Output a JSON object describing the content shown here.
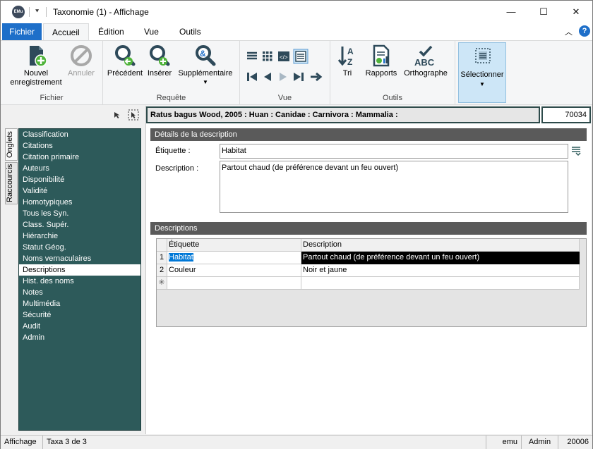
{
  "window": {
    "app_logo": "EMu",
    "title": "Taxonomie (1) - Affichage",
    "minimize": "—",
    "maximize": "☐",
    "close": "✕"
  },
  "ribbon_tabs": {
    "file": "Fichier",
    "items": [
      "Accueil",
      "Édition",
      "Vue",
      "Outils"
    ]
  },
  "ribbon": {
    "groups": {
      "fichier": "Fichier",
      "requete": "Requête",
      "vue": "Vue",
      "outils": "Outils"
    },
    "nouvel_line1": "Nouvel",
    "nouvel_line2": "enregistrement",
    "annuler": "Annuler",
    "precedent": "Précédent",
    "inserer": "Insérer",
    "supplementaire": "Supplémentaire",
    "tri": "Tri",
    "rapports": "Rapports",
    "orthographe": "Orthographe",
    "abc": "ABC",
    "selectionner": "Sélectionner"
  },
  "left": {
    "vertical_tabs": [
      "Onglets",
      "Raccourcis"
    ],
    "nav_items": [
      "Classification",
      "Citations",
      "Citation primaire",
      "Auteurs",
      "Disponibilité",
      "Validité",
      "Homotypiques",
      "Tous les Syn.",
      "Class. Supér.",
      "Hiérarchie",
      "Statut Géog.",
      "Noms vernaculaires",
      "Descriptions",
      "Hist. des noms",
      "Notes",
      "Multimédia",
      "Sécurité",
      "Audit",
      "Admin"
    ],
    "active_index": 12
  },
  "record": {
    "summary": "Ratus bagus Wood, 2005 : Huan : Canidae : Carnivora : Mammalia :",
    "irn": "70034"
  },
  "details": {
    "header": "Détails de la description",
    "label_caption": "Étiquette :",
    "label_value": "Habitat",
    "description_caption": "Description :",
    "description_value": "Partout chaud (de préférence devant un feu ouvert)"
  },
  "descriptions": {
    "header": "Descriptions",
    "columns": [
      "Étiquette",
      "Description"
    ],
    "rows": [
      {
        "num": "1",
        "label": "Habitat",
        "description": "Partout chaud (de préférence devant un feu ouvert)"
      },
      {
        "num": "2",
        "label": "Couleur",
        "description": "Noir et jaune"
      }
    ],
    "new_row_marker": "✳"
  },
  "status": {
    "mode": "Affichage",
    "position": "Taxa 3 de 3",
    "db": "emu",
    "user": "Admin",
    "number": "20006"
  },
  "colors": {
    "file_tab": "#1e6fc9",
    "nav_background": "#2d5a5a",
    "section_header": "#5a5a5a",
    "selected_row": "#000000"
  }
}
